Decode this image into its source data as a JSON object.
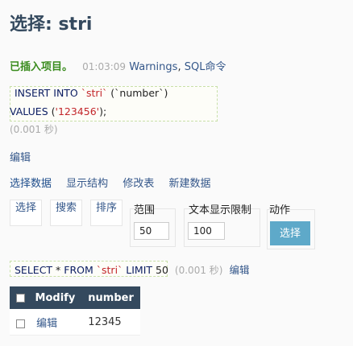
{
  "header": {
    "title": "选择: stri"
  },
  "message": {
    "success": "已插入项目。",
    "time": "01:03:09",
    "warnings": "Warnings",
    "separator": ",",
    "sql_command": "SQL命令"
  },
  "sql": {
    "insert_kw": "INSERT INTO",
    "table": "`stri`",
    "column": "(`number`)",
    "values_kw": "VALUES",
    "values_open": "(",
    "value": "'123456'",
    "values_close": ");",
    "duration": "(0.001 秒)"
  },
  "edit_label": "编辑",
  "tabs": [
    "选择数据",
    "显示结构",
    "修改表",
    "新建数据"
  ],
  "options": {
    "select_label": "选择",
    "search_label": "搜索",
    "sort_label": "排序",
    "range_label": "范围",
    "range_value": "50",
    "text_limit_label": "文本显示限制",
    "text_limit_value": "100",
    "action_label": "动作",
    "action_button": "选择"
  },
  "query": {
    "select_kw": "SELECT",
    "star": "*",
    "from_kw": "FROM",
    "table": "`stri`",
    "limit_kw": "LIMIT",
    "limit_value": "50",
    "duration": "(0.001 秒)",
    "edit_link": "编辑"
  },
  "results": {
    "columns": [
      "Modify",
      "number"
    ],
    "rows": [
      {
        "edit": "编辑",
        "number": "12345"
      }
    ]
  },
  "colors": {
    "header_bg": "#34495e",
    "link": "#34578a",
    "success": "#3a8c1e",
    "button": "#5ea9c9",
    "sql_string": "#c3272b"
  }
}
